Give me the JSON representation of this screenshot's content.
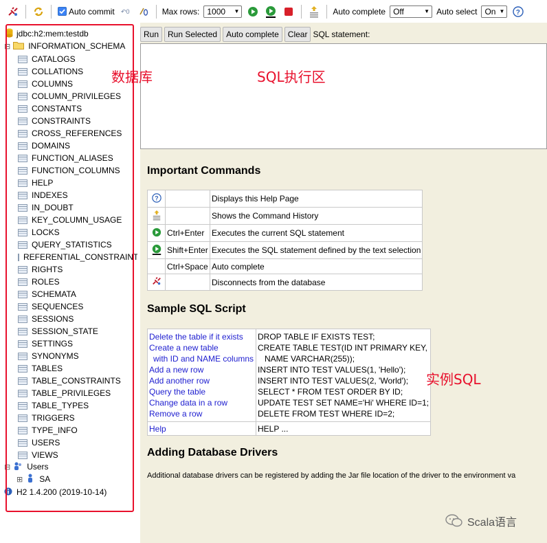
{
  "toolbar": {
    "auto_commit_label": "Auto commit",
    "max_rows_label": "Max rows:",
    "max_rows_value": "1000",
    "auto_complete_label": "Auto complete",
    "auto_complete_value": "Off",
    "auto_select_label": "Auto select",
    "auto_select_value": "On"
  },
  "tree": {
    "connection": "jdbc:h2:mem:testdb",
    "schema": "INFORMATION_SCHEMA",
    "tables": [
      "CATALOGS",
      "COLLATIONS",
      "COLUMNS",
      "COLUMN_PRIVILEGES",
      "CONSTANTS",
      "CONSTRAINTS",
      "CROSS_REFERENCES",
      "DOMAINS",
      "FUNCTION_ALIASES",
      "FUNCTION_COLUMNS",
      "HELP",
      "INDEXES",
      "IN_DOUBT",
      "KEY_COLUMN_USAGE",
      "LOCKS",
      "QUERY_STATISTICS",
      "REFERENTIAL_CONSTRAINTS",
      "RIGHTS",
      "ROLES",
      "SCHEMATA",
      "SEQUENCES",
      "SESSIONS",
      "SESSION_STATE",
      "SETTINGS",
      "SYNONYMS",
      "TABLES",
      "TABLE_CONSTRAINTS",
      "TABLE_PRIVILEGES",
      "TABLE_TYPES",
      "TRIGGERS",
      "TYPE_INFO",
      "USERS",
      "VIEWS"
    ],
    "users": "Users",
    "user_sa": "SA",
    "version": "H2 1.4.200 (2019-10-14)"
  },
  "buttons": {
    "run": "Run",
    "run_selected": "Run Selected",
    "auto_complete": "Auto complete",
    "clear": "Clear",
    "sql_statement_label": "SQL statement:"
  },
  "important": {
    "title": "Important Commands",
    "rows": [
      {
        "key": "",
        "desc": "Displays this Help Page"
      },
      {
        "key": "",
        "desc": "Shows the Command History"
      },
      {
        "key": "Ctrl+Enter",
        "desc": "Executes the current SQL statement"
      },
      {
        "key": "Shift+Enter",
        "desc": "Executes the SQL statement defined by the text selection"
      },
      {
        "key": "Ctrl+Space",
        "desc": "Auto complete"
      },
      {
        "key": "",
        "desc": "Disconnects from the database"
      }
    ]
  },
  "sample": {
    "title": "Sample SQL Script",
    "links": [
      "Delete the table if it exists",
      "Create a new table",
      "with ID and NAME columns",
      "Add a new row",
      "Add another row",
      "Query the table",
      "Change data in a row",
      "Remove a row"
    ],
    "sql": [
      "DROP TABLE IF EXISTS TEST;",
      "CREATE TABLE TEST(ID INT PRIMARY KEY,",
      "NAME VARCHAR(255));",
      "INSERT INTO TEST VALUES(1, 'Hello');",
      "INSERT INTO TEST VALUES(2, 'World');",
      "SELECT * FROM TEST ORDER BY ID;",
      "UPDATE TEST SET NAME='Hi' WHERE ID=1;",
      "DELETE FROM TEST WHERE ID=2;"
    ],
    "help_link": "Help",
    "help_sql": "HELP ..."
  },
  "drivers": {
    "title": "Adding Database Drivers",
    "text": "Additional database drivers can be registered by adding the Jar file location of the driver to the environment va"
  },
  "annotations": {
    "database": "数据库",
    "sql_area": "SQL执行区",
    "sample_sql": "实例SQL"
  },
  "watermark": "Scala语言"
}
